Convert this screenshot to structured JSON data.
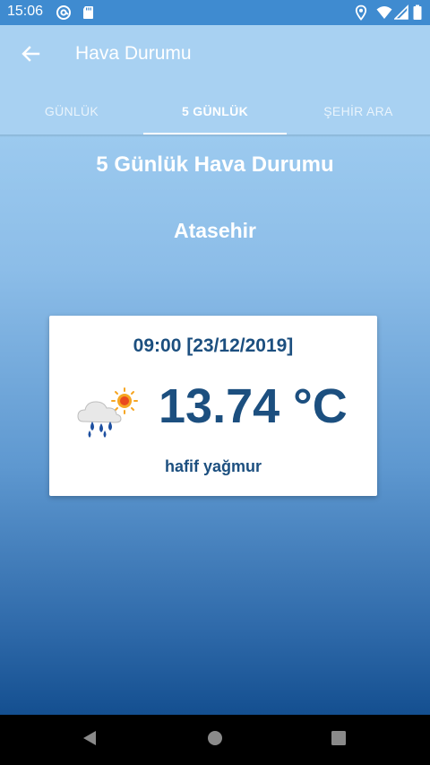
{
  "status_bar": {
    "time": "15:06",
    "icons": [
      "at-sign-icon",
      "sd-card-icon",
      "location-icon",
      "wifi-icon",
      "signal-icon",
      "battery-icon"
    ]
  },
  "app_bar": {
    "title": "Hava Durumu",
    "back_icon": "arrow-back-icon",
    "tabs": [
      {
        "label": "GÜNLÜK",
        "active": false
      },
      {
        "label": "5 GÜNLÜK",
        "active": true
      },
      {
        "label": "ŞEHİR ARA",
        "active": false
      }
    ]
  },
  "main": {
    "heading": "5 Günlük Hava Durumu",
    "city": "Atasehir",
    "forecast_card": {
      "datetime": "09:00 [23/12/2019]",
      "icon": "light-rain-sun-icon",
      "temperature": "13.74 °C",
      "description": "hafif yağmur"
    }
  },
  "nav_bar": {
    "icons": [
      "nav-back-icon",
      "nav-home-icon",
      "nav-recents-icon"
    ]
  },
  "colors": {
    "status_bar": "#3f8bd0",
    "app_bar": "#a8d1f2",
    "card_text": "#1c4f7f",
    "background_bottom": "#144f90"
  }
}
